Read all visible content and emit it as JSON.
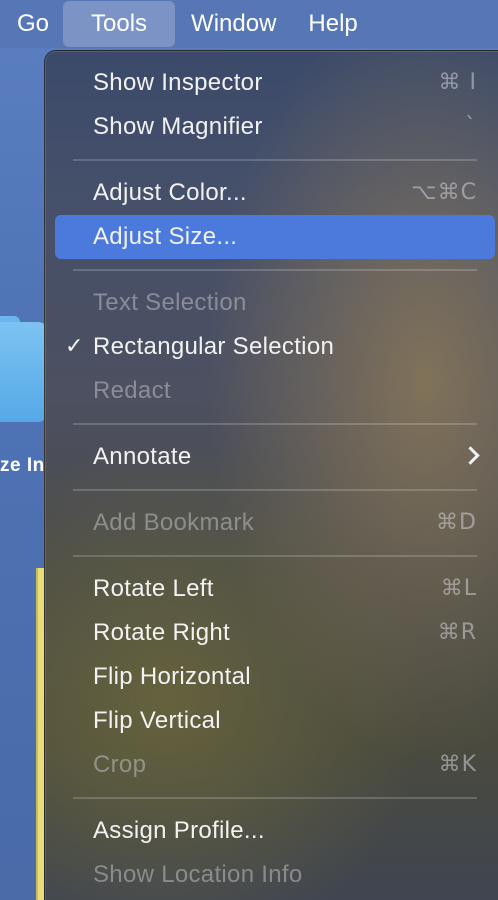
{
  "menubar": {
    "items": [
      {
        "label": "Go"
      },
      {
        "label": "Tools"
      },
      {
        "label": "Window"
      },
      {
        "label": "Help"
      }
    ],
    "active": "Tools"
  },
  "desktop": {
    "label_fragment": "ze In"
  },
  "tools_menu": {
    "items": [
      {
        "label": "Show Inspector",
        "shortcut": "⌘ I",
        "enabled": true
      },
      {
        "label": "Show Magnifier",
        "shortcut": "`",
        "enabled": true
      },
      {
        "label": "Adjust Color...",
        "shortcut": "⌥⌘C",
        "enabled": true
      },
      {
        "label": "Adjust Size...",
        "shortcut": "",
        "enabled": true,
        "highlighted": true
      },
      {
        "label": "Text Selection",
        "shortcut": "",
        "enabled": false
      },
      {
        "label": "Rectangular Selection",
        "shortcut": "",
        "enabled": true,
        "checked": true
      },
      {
        "label": "Redact",
        "shortcut": "",
        "enabled": false
      },
      {
        "label": "Annotate",
        "shortcut": "",
        "enabled": true,
        "submenu": true
      },
      {
        "label": "Add Bookmark",
        "shortcut": "⌘D",
        "enabled": false
      },
      {
        "label": "Rotate Left",
        "shortcut": "⌘L",
        "enabled": true
      },
      {
        "label": "Rotate Right",
        "shortcut": "⌘R",
        "enabled": true
      },
      {
        "label": "Flip Horizontal",
        "shortcut": "",
        "enabled": true
      },
      {
        "label": "Flip Vertical",
        "shortcut": "",
        "enabled": true
      },
      {
        "label": "Crop",
        "shortcut": "⌘K",
        "enabled": false
      },
      {
        "label": "Assign Profile...",
        "shortcut": "",
        "enabled": true
      },
      {
        "label": "Show Location Info",
        "shortcut": "",
        "enabled": false
      }
    ],
    "checkmark_icon": "checkmark-icon",
    "submenu_icon": "chevron-right-icon"
  },
  "colors": {
    "highlight": "#4b79dc",
    "menubar": "#5676b4"
  }
}
